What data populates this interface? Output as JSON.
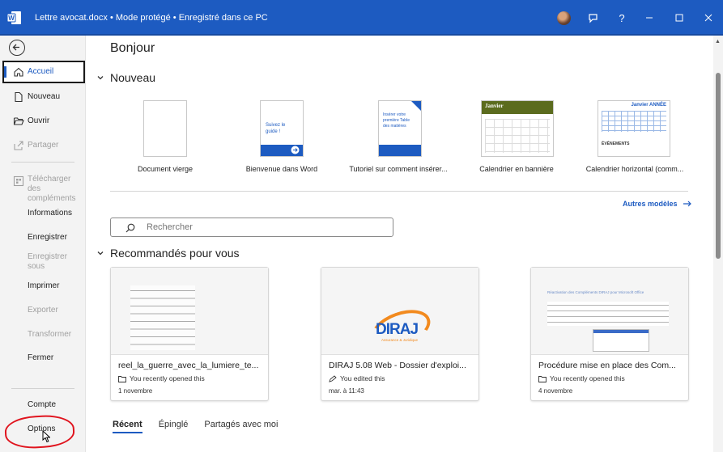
{
  "window": {
    "title": "Lettre avocat.docx  •  Mode protégé  •  Enregistré dans ce PC",
    "buttons": [
      "feedback-icon",
      "help",
      "minimize",
      "maximize",
      "close"
    ],
    "help_label": "?"
  },
  "sidebar": {
    "items": [
      {
        "label": "Accueil",
        "icon": "home-icon",
        "state": "active"
      },
      {
        "label": "Nouveau",
        "icon": "new-doc-icon",
        "state": "enabled"
      },
      {
        "label": "Ouvrir",
        "icon": "folder-open-icon",
        "state": "enabled"
      },
      {
        "label": "Partager",
        "icon": "share-icon",
        "state": "disabled"
      },
      {
        "label": "Télécharger des compléments",
        "icon": "addins-icon",
        "state": "disabled"
      },
      {
        "label": "Informations",
        "state": "enabled"
      },
      {
        "label": "Enregistrer",
        "state": "enabled"
      },
      {
        "label": "Enregistrer sous",
        "state": "disabled"
      },
      {
        "label": "Imprimer",
        "state": "enabled"
      },
      {
        "label": "Exporter",
        "state": "disabled"
      },
      {
        "label": "Transformer",
        "state": "disabled"
      },
      {
        "label": "Fermer",
        "state": "enabled"
      },
      {
        "label": "Compte",
        "state": "enabled"
      },
      {
        "label": "Options",
        "state": "enabled"
      }
    ]
  },
  "main": {
    "greeting": "Bonjour",
    "new_section": "Nouveau",
    "templates": [
      {
        "label": "Document vierge"
      },
      {
        "label": "Bienvenue dans Word",
        "thumb_text": "Suivez le guide !"
      },
      {
        "label": "Tutoriel sur comment insérer...",
        "thumb_text": "Insérer votre première Table des matières"
      },
      {
        "label": "Calendrier en bannière",
        "thumb_text": "Janvier"
      },
      {
        "label": "Calendrier horizontal (comm...",
        "thumb_text": "Janvier ANNÉE",
        "thumb_text2": "ÉVÉNEMENTS"
      }
    ],
    "more_templates": "Autres modèles",
    "search_placeholder": "Rechercher",
    "recommended_section": "Recommandés pour vous",
    "recommended": [
      {
        "name": "reel_la_guerre_avec_la_lumiere_te...",
        "status": "You recently opened this",
        "status_icon": "folder-icon",
        "date": "1 novembre"
      },
      {
        "name": "DIRAJ 5.08 Web - Dossier d'exploi...",
        "status": "You edited this",
        "status_icon": "pencil-icon",
        "date": "mar. à 11:43",
        "logo_text": "DIRAJ",
        "logo_subtext": "Assurance & Juridique"
      },
      {
        "name": "Procédure mise en place des Com...",
        "status": "You recently opened this",
        "status_icon": "folder-icon",
        "date": "4 novembre",
        "preview_heading": "Réactivation des Compléments DIRAJ pour Microsoft Office"
      }
    ],
    "tabs": [
      "Récent",
      "Épinglé",
      "Partagés avec moi"
    ],
    "active_tab": "Récent"
  },
  "colors": {
    "titlebar": "#1d5bc1",
    "accent": "#1d5bc1",
    "annotation": "#e0141e",
    "sidebar_bg": "#f3f3f3"
  }
}
